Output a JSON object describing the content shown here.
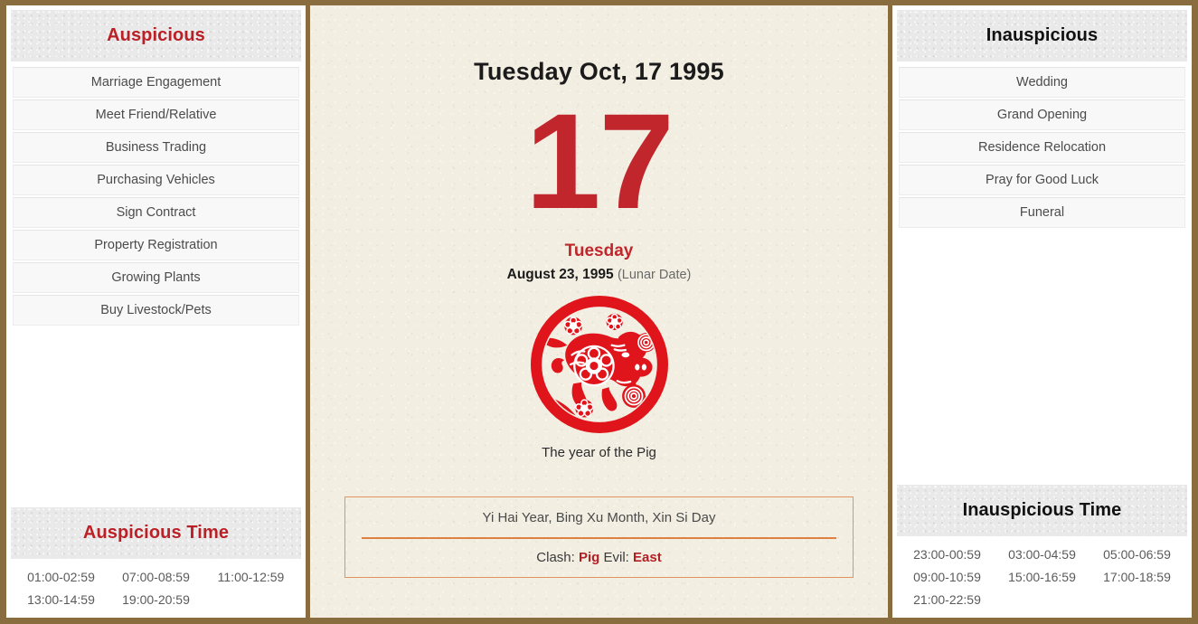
{
  "theme": {
    "frame_color": "#8a6d3f",
    "accent_red": "#bb2026",
    "day_red": "#c0262c",
    "paper_bg": "#f2eee2",
    "header_bg": "#e9e9e9",
    "info_border": "#e2935f"
  },
  "left_panel": {
    "header": "Auspicious",
    "items": [
      "Marriage Engagement",
      "Meet Friend/Relative",
      "Business Trading",
      "Purchasing Vehicles",
      "Sign Contract",
      "Property Registration",
      "Growing Plants",
      "Buy Livestock/Pets"
    ],
    "time_header": "Auspicious Time",
    "times": [
      "01:00-02:59",
      "07:00-08:59",
      "11:00-12:59",
      "13:00-14:59",
      "19:00-20:59"
    ]
  },
  "center_panel": {
    "title": "Tuesday Oct, 17 1995",
    "day_number": "17",
    "weekday": "Tuesday",
    "lunar_date": "August 23, 1995",
    "lunar_tag": "(Lunar Date)",
    "zodiac_icon": "zodiac-pig-papercut-icon",
    "zodiac_caption": "The year of the Pig",
    "pillars": "Yi Hai Year, Bing Xu Month, Xin Si Day",
    "clash_label": "Clash:",
    "clash_value": "Pig",
    "evil_label": "Evil:",
    "evil_value": "East"
  },
  "right_panel": {
    "header": "Inauspicious",
    "items": [
      "Wedding",
      "Grand Opening",
      "Residence Relocation",
      "Pray for Good Luck",
      "Funeral"
    ],
    "time_header": "Inauspicious Time",
    "times": [
      "23:00-00:59",
      "03:00-04:59",
      "05:00-06:59",
      "09:00-10:59",
      "15:00-16:59",
      "17:00-18:59",
      "21:00-22:59"
    ]
  }
}
